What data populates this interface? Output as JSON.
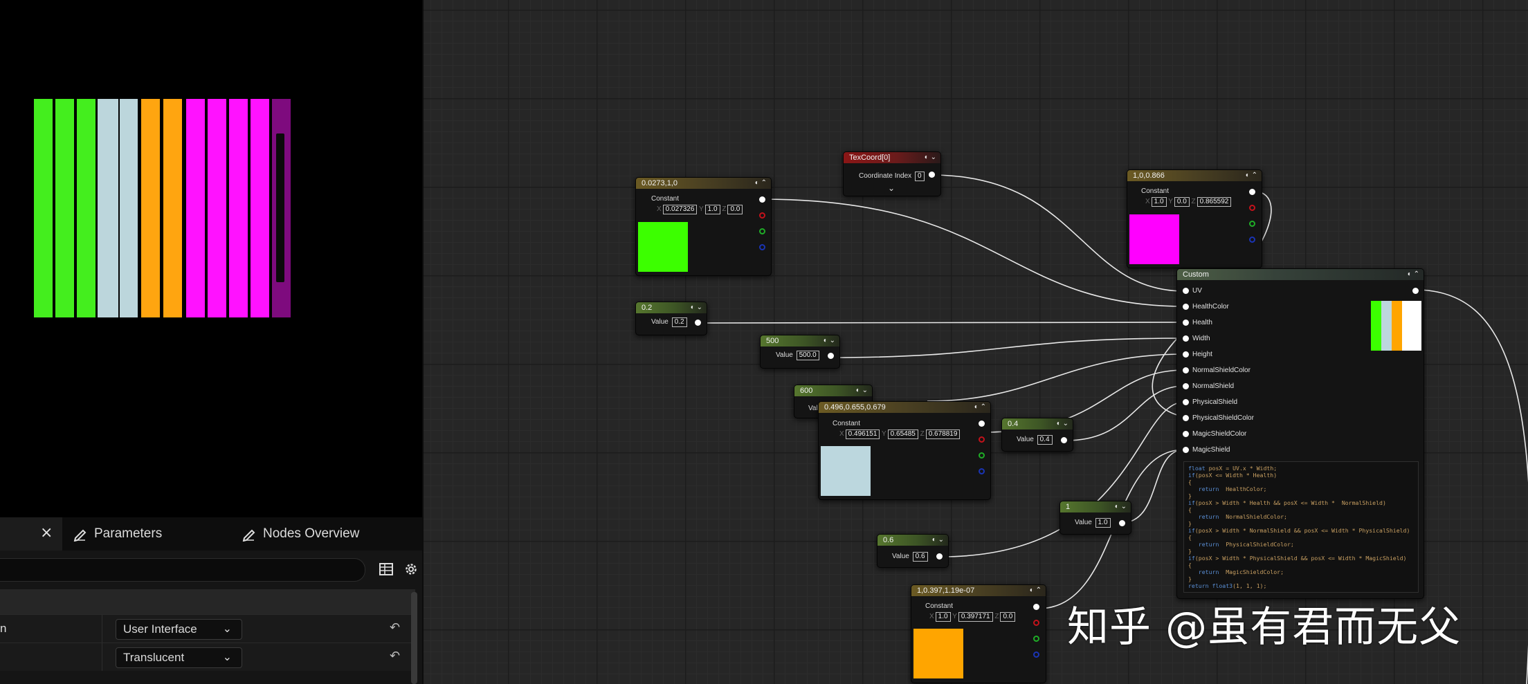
{
  "panel": {
    "tabs": {
      "close": "×",
      "parameters": "Parameters",
      "nodes_overview": "Nodes Overview"
    },
    "rows": [
      {
        "name_tail": "n",
        "value": "User Interface"
      },
      {
        "name_tail": "",
        "value": "Translucent"
      }
    ]
  },
  "preview": {
    "bars": [
      {
        "color": "#44ee1e"
      },
      {
        "color": "#44ee1e"
      },
      {
        "color": "#44ee1e"
      },
      {
        "color": "#bcd6dc"
      },
      {
        "color": "#bcd6dc"
      },
      {
        "color": "#ffa510"
      },
      {
        "color": "#ffa510"
      },
      {
        "color": "#ff12ff"
      },
      {
        "color": "#ff12ff"
      },
      {
        "color": "#ff12ff"
      },
      {
        "color": "#ff12ff"
      },
      {
        "color": "#7e0b7e"
      }
    ]
  },
  "nodes": {
    "const_green": {
      "title": "0.0273,1,0",
      "label": "Constant",
      "x": "0.027326",
      "y": "1.0",
      "z": "0.0",
      "color": "#3cff00"
    },
    "texcoord": {
      "title": "TexCoord[0]",
      "label": "Coordinate Index",
      "value": "0"
    },
    "const_magenta": {
      "title": "1,0,0.866",
      "label": "Constant",
      "x": "1.0",
      "y": "0.0",
      "z": "0.865592",
      "color": "#ff00ff"
    },
    "scalar_02": {
      "title": "0.2",
      "label": "Value",
      "value": "0.2"
    },
    "scalar_500": {
      "title": "500",
      "label": "Value",
      "value": "500.0"
    },
    "scalar_600": {
      "title": "600",
      "label": "Valu"
    },
    "const_blue": {
      "title": "0.496,0.655,0.679",
      "label": "Constant",
      "x": "0.496151",
      "y": "0.65485",
      "z": "0.678819",
      "color": "#bcd7de"
    },
    "scalar_04": {
      "title": "0.4",
      "label": "Value",
      "value": "0.4"
    },
    "scalar_1": {
      "title": "1",
      "label": "Value",
      "value": "1.0"
    },
    "scalar_06": {
      "title": "0.6",
      "label": "Value",
      "value": "0.6"
    },
    "const_orange": {
      "title": "1,0.397,1.19e-07",
      "label": "Constant",
      "x": "1.0",
      "y": "0.397171",
      "z": "0.0",
      "color": "#ffa500"
    },
    "custom": {
      "title": "Custom",
      "inputs": [
        "UV",
        "HealthColor",
        "Health",
        "Width",
        "Height",
        "NormalShieldColor",
        "NormalShield",
        "PhysicalShield",
        "PhysicalShieldColor",
        "MagicShieldColor",
        "MagicShield"
      ],
      "code": [
        "float posX = UV.x * Width;",
        "if(posX <= Width * Health)",
        "{",
        "   return  HealthColor;",
        "}",
        "if(posX > Width * Health && posX <= Width *  NormalShield)",
        "{",
        "   return  NormalShieldColor;",
        "}",
        "if(posX > Width * NormalShield && posX <= Width * PhysicalShield)",
        "{",
        "   return  PhysicalShieldColor;",
        "}",
        "if(posX > Width * PhysicalShield && posX <= Width * MagicShield)",
        "{",
        "   return  MagicShieldColor;",
        "}",
        "return float3(1, 1, 1);"
      ]
    }
  },
  "watermark": "知乎 @虽有君而无父"
}
